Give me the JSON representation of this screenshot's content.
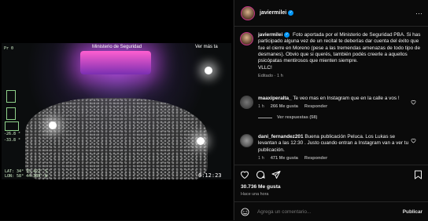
{
  "media": {
    "hud": {
      "top_label": "Ministerio de Seguridad",
      "top_right": "Ver más ta",
      "left_top": "Pr 0",
      "left_vals": [
        "-26.8 °",
        "-33.8 °"
      ],
      "lat": "LAT: 34° 35.422' S",
      "lon": "LON: 58° 44.389' W",
      "time": "6:12:23"
    }
  },
  "header": {
    "username": "javiermilei",
    "verified": "✓",
    "more": "···"
  },
  "post": {
    "username": "javiermilei",
    "caption": "Foto aportada por el Ministerio de Seguridad PBA. Si has participado alguna vez de un recital te deberías dar cuenta del éxito que fue el cierre en Moreno (pese a las tremendas amenazas de todo tipo de desmanes). Obvio que si querés, también podés creerle a aquellos psicópatas mentirosos que mienten siempre.",
    "signoff": "VLLC!",
    "meta": "Editado · 1 h"
  },
  "comments": [
    {
      "username": "maaxiperalta_",
      "text": "Te veo mas en Instagram que en la calle a vos !",
      "time": "1 h",
      "likes": "266 Me gusta",
      "reply": "Responder",
      "view_replies": "Ver respuestas (58)"
    },
    {
      "username": "dani_fernandez201",
      "text": "Buena publicación Peluca. Los Lukas se levantan a las 12:30 . Justo cuando entran a Instagram van a ver tu publicación.",
      "time": "1 h",
      "likes": "471 Me gusta",
      "reply": "Responder"
    }
  ],
  "actions": {
    "likes": "30.736 Me gusta",
    "time": "Hace una hora"
  },
  "add_comment": {
    "placeholder": "Agrega un comentario...",
    "publish": "Publicar"
  },
  "colors": {
    "accent": "#0095f6",
    "muted": "#a8a8a8",
    "background": "#000000"
  }
}
